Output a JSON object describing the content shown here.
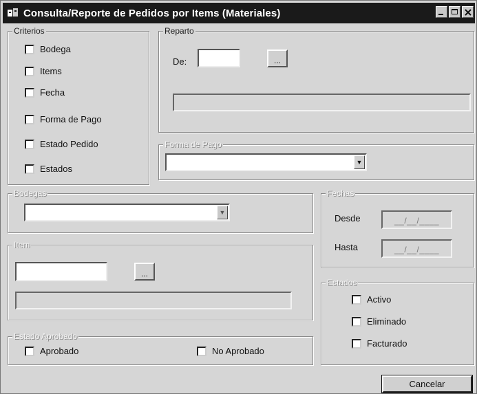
{
  "window": {
    "title": "Consulta/Reporte de Pedidos por Items (Materiales)",
    "controls": [
      "minimize-icon",
      "maximize-icon",
      "close-icon"
    ]
  },
  "criterios": {
    "legend": "Criterios",
    "items": [
      "Bodega",
      "Items",
      "Fecha",
      "Forma de Pago",
      "Estado Pedido",
      "Estados"
    ]
  },
  "reparto": {
    "legend": "Reparto",
    "de_label": "De:",
    "de_value": "",
    "browse_label": "...",
    "description_value": ""
  },
  "forma_pago": {
    "legend": "Forma de Pago",
    "selected": ""
  },
  "bodegas": {
    "legend": "Bodegas",
    "selected": ""
  },
  "fechas": {
    "legend": "Fechas",
    "desde_label": "Desde",
    "desde_value": "__/__/____",
    "hasta_label": "Hasta",
    "hasta_value": "__/__/____"
  },
  "item": {
    "legend": "Item",
    "code_value": "",
    "browse_label": "...",
    "description_value": ""
  },
  "estados": {
    "legend": "Estados",
    "items": [
      "Activo",
      "Eliminado",
      "Facturado"
    ]
  },
  "estado_aprobado": {
    "legend": "Estado Aprobado",
    "aprobado": "Aprobado",
    "no_aprobado": "No Aprobado"
  },
  "actions": {
    "cancel_label": "Cancelar"
  }
}
